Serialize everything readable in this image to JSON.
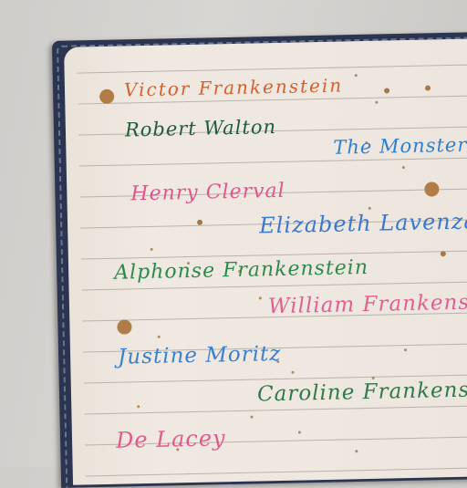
{
  "names": [
    {
      "text": "Victor Frankenstein",
      "color": "#d6602e"
    },
    {
      "text": "Robert Walton",
      "color": "#1f5c3a"
    },
    {
      "text": "The Monster",
      "color": "#2f7fcf"
    },
    {
      "text": "Henry Clerval",
      "color": "#e0558e"
    },
    {
      "text": "Elizabeth Lavenza",
      "color": "#3a78d0"
    },
    {
      "text": "Alphonse Frankenstein",
      "color": "#2b8a4c"
    },
    {
      "text": "William Frankenstein",
      "color": "#e2608f"
    },
    {
      "text": "Justine Moritz",
      "color": "#3a7fd0"
    },
    {
      "text": "Caroline Frankenstein",
      "color": "#2f7a48"
    },
    {
      "text": "De Lacey",
      "color": "#e25a8c"
    }
  ]
}
